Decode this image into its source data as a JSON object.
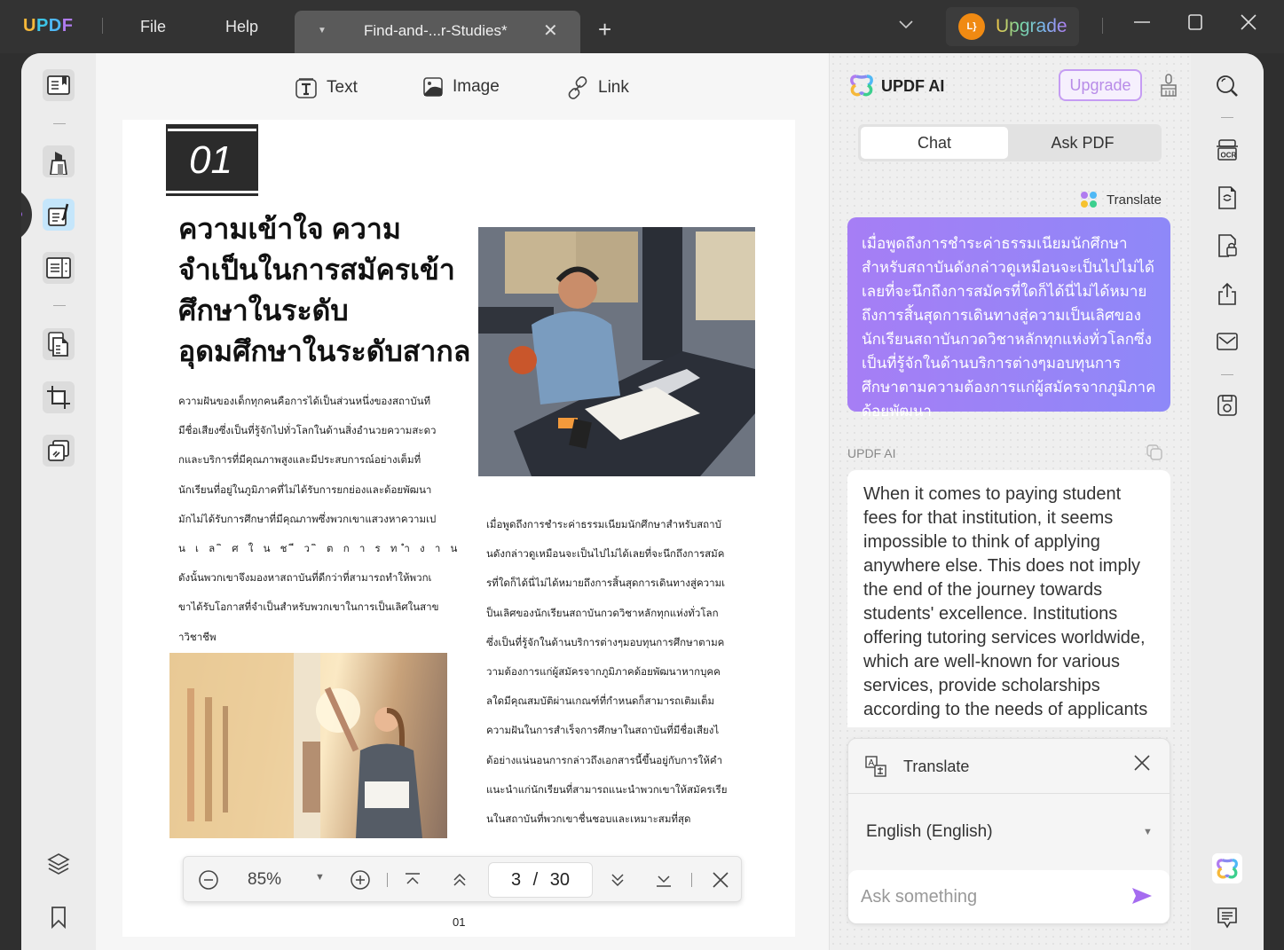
{
  "titlebar": {
    "logo_letters": [
      "U",
      "P",
      "D",
      "F"
    ],
    "menu": [
      "File",
      "Help"
    ],
    "tab_title": "Find-and-...r-Studies*",
    "tab_close": "✕",
    "new_tab": "+",
    "dropdown": "⌄",
    "avatar_initials": "L}",
    "upgrade_label": "Upgrade",
    "minimize": "—",
    "maximize": "☐",
    "close": "✕"
  },
  "left_sidebar": {
    "tools": [
      "reader",
      "comment",
      "edit-pdf",
      "form-fields",
      "organize-pages",
      "crop",
      "watermark"
    ],
    "active_tool": "edit-pdf",
    "bottom": [
      "layers",
      "bookmark"
    ]
  },
  "edit_toolbar": {
    "text_label": "Text",
    "image_label": "Image",
    "link_label": "Link"
  },
  "document": {
    "section_number": "01",
    "heading": "ความเข้าใจ ความจำเป็นในการสมัครเข้าศึกษาในระดับอุดมศึกษาในระดับสากล",
    "left_paragraph_lines": [
      "ความฝันของเด็กทุกคนคือการได้เป็นส่วนหนึ่งของสถาบันที",
      "มีชื่อเสียงซึ่งเป็นที่รู้จักไปทั่วโลกในด้านสิ่งอำนวยความสะดว",
      "กและบริการที่มีคุณภาพสูงและมีประสบการณ์อย่างเต็มที่",
      "นักเรียนที่อยู่ในภูมิภาคที่ไม่ได้รับการยกย่องและด้อยพัฒนา",
      "มักไม่ได้รับการศึกษาที่มีคุณภาพซึ่งพวกเขาแสวงหาความเป",
      "น เ ล ิ ศ ใ น ช ี ว ิ ต ก า ร ท ำ ง า น",
      "ดังนั้นพวกเขาจึงมองหาสถาบันที่ดีกว่าที่สามารถทำให้พวกเ",
      "ขาได้รับโอกาสที่จำเป็นสำหรับพวกเขาในการเป็นเลิศในสาข",
      "าวิชาชีพ"
    ],
    "right_paragraph_lines": [
      "เมื่อพูดถึงการชำระค่าธรรมเนียมนักศึกษาสำหรับสถาบั",
      "นดังกล่าวดูเหมือนจะเป็นไปไม่ได้เลยที่จะนึกถึงการสมัค",
      "รที่ใดก็ได้นี่ไม่ได้หมายถึงการสิ้นสุดการเดินทางสู่ความเ",
      "ป็นเลิศของนักเรียนสถาบันกวดวิชาหลักทุกแห่งทั่วโลก",
      "ซึ่งเป็นที่รู้จักในด้านบริการต่างๆมอบทุนการศึกษาตามค",
      "วามต้องการแก่ผู้สมัครจากภูมิภาคด้อยพัฒนาหากบุคค",
      "ลใดมีคุณสมบัติผ่านเกณฑ์ที่กำหนดก็สามารถเติมเต็ม",
      "ความฝันในการสำเร็จการศึกษาในสถาบันที่มีชื่อเสียงไ",
      "ด้อย่างแน่นอนการกล่าวถึงเอกสารนี้ขึ้นอยู่กับการให้คำ",
      "แนะนำแก่นักเรียนที่สามารถแนะนำพวกเขาให้สมัครเรีย",
      "นในสถาบันที่พวกเขาชื่นชอบและเหมาะสมที่สุด"
    ],
    "images": [
      "student-with-headphones-at-laptop",
      "student-at-library-bookshelf"
    ],
    "page_footer": "01"
  },
  "zoom_bar": {
    "zoom_out": "−",
    "zoom_value": "85%",
    "zoom_in": "+",
    "current_page": "3",
    "page_separator": "/",
    "total_pages": "30"
  },
  "ai_panel": {
    "title": "UPDF AI",
    "upgrade_label": "Upgrade",
    "tabs": [
      {
        "label": "Chat",
        "active": true
      },
      {
        "label": "Ask PDF",
        "active": false
      }
    ],
    "mode_chip": "Translate",
    "user_message": "เมื่อพูดถึงการชำระค่าธรรมเนียมนักศึกษาสำหรับสถาบันดังกล่าวดูเหมือนจะเป็นไปไม่ได้เลยที่จะนึกถึงการสมัครที่ใดก็ได้นี่ไม่ได้หมายถึงการสิ้นสุดการเดินทางสู่ความเป็นเลิศของนักเรียนสถาบันกวดวิชาหลักทุกแห่งทั่วโลกซึ่งเป็นที่รู้จักในด้านบริการต่างๆมอบทุนการศึกษาตามความต้องการแก่ผู้สมัครจากภูมิภาคด้อยพัฒนา",
    "ai_label": "UPDF AI",
    "ai_message": "When it comes to paying student fees for that institution, it seems impossible to think of applying anywhere else. This does not imply the end of the journey towards students' excellence. Institutions offering tutoring services worldwide, which are well-known for various services, provide scholarships according to the needs of applicants",
    "translate_box": {
      "title": "Translate",
      "close": "✕",
      "language": "English (English)"
    },
    "input_placeholder": "Ask something",
    "accent_gradient": [
      "#a67ef5",
      "#8e88f8"
    ]
  },
  "right_sidebar": {
    "tools": [
      "search",
      "ocr",
      "convert",
      "protect",
      "share",
      "email",
      "save"
    ],
    "bottom": [
      "updf-ai",
      "comments"
    ]
  },
  "colors": {
    "titlebar_bg": "#333333",
    "active_tool_bg": "#c5e6fb",
    "accent_purple": "#a56cf0",
    "avatar_orange": "#f08a12"
  }
}
